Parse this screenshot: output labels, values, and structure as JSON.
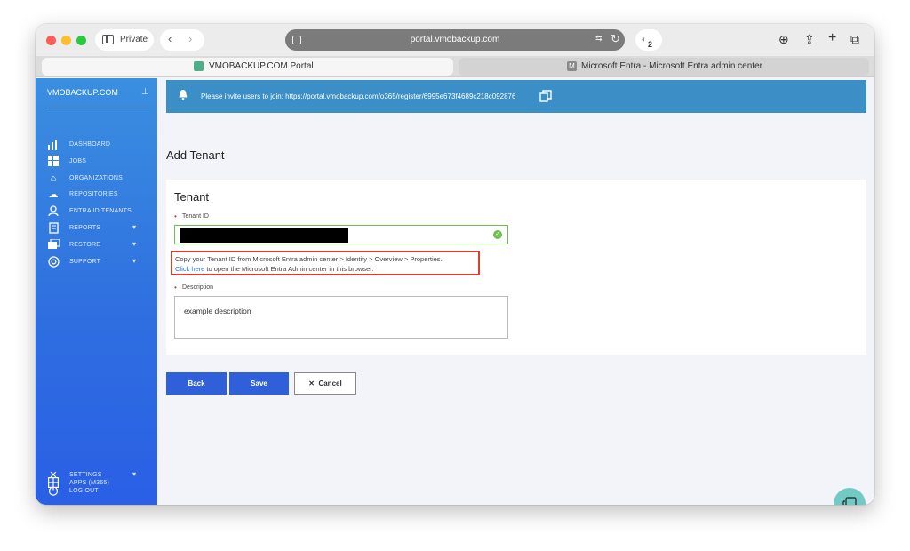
{
  "browser": {
    "private_label": "Private",
    "url": "portal.vmobackup.com",
    "shield_count": "2",
    "tabs": [
      {
        "title": "VMOBACKUP.COM Portal",
        "favicon": "portal-favicon"
      },
      {
        "title": "Microsoft Entra - Microsoft Entra admin center",
        "favicon_letter": "M"
      }
    ]
  },
  "sidebar": {
    "brand": "VMOBACKUP.COM",
    "items": [
      {
        "label": "DASHBOARD",
        "icon": "bar-chart-icon"
      },
      {
        "label": "JOBS",
        "icon": "windows-icon"
      },
      {
        "label": "ORGANIZATIONS",
        "icon": "building-icon"
      },
      {
        "label": "REPOSITORIES",
        "icon": "cloud-upload-icon"
      },
      {
        "label": "ENTRA ID TENANTS",
        "icon": "user-icon"
      },
      {
        "label": "REPORTS",
        "icon": "document-icon"
      },
      {
        "label": "RESTORE",
        "icon": "restore-icon"
      },
      {
        "label": "SUPPORT",
        "icon": "lifebuoy-icon"
      }
    ],
    "bottom_items": [
      {
        "label": "APPS (M365)",
        "icon": "grid-icon"
      },
      {
        "label": "SETTINGS",
        "icon": "tools-icon"
      },
      {
        "label": "LOG OUT",
        "icon": "power-icon"
      }
    ]
  },
  "banner": {
    "message": "Please invite users to join: https://portal.vmobackup.com/o365/register/6995e673f4689c218c092876"
  },
  "page": {
    "title": "Add Tenant",
    "card_title": "Tenant",
    "tenant_id_label": "Tenant ID",
    "help_line1": "Copy your Tenant ID from Microsoft Entra admin center > Identity > Overview > Properties.",
    "help_link": "Click here",
    "help_line2": " to open the Microsoft Entra Admin center in this browser.",
    "description_label": "Description",
    "description_value": "example description",
    "required_marker": "•"
  },
  "buttons": {
    "back": "Back",
    "save": "Save",
    "cancel": "Cancel",
    "cancel_icon": "✕"
  },
  "colors": {
    "sidebar_top": "#3a8fe0",
    "sidebar_bottom": "#2a5fe6",
    "banner": "#3b8fc6",
    "primary_button": "#2f5fd9",
    "valid_green": "#6dc04b",
    "highlight_red": "#d9412e",
    "chat_button": "#73c9c3"
  }
}
